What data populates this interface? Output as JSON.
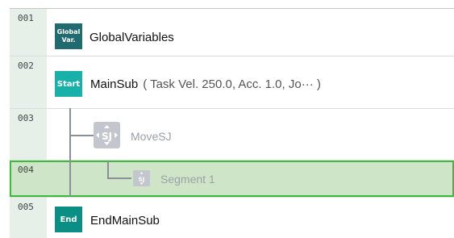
{
  "lines": [
    {
      "num": "001",
      "badge": [
        "Global",
        "Var."
      ],
      "label": "GlobalVariables",
      "params": ""
    },
    {
      "num": "002",
      "badge": [
        "Start"
      ],
      "label": "MainSub",
      "params": "( Task Vel. 250.0, Acc. 1.0, Jo··· )"
    },
    {
      "num": "003",
      "badge": [],
      "label": "MoveSJ",
      "params": ""
    },
    {
      "num": "004",
      "badge": [],
      "label": "Segment 1",
      "params": ""
    },
    {
      "num": "005",
      "badge": [
        "End"
      ],
      "label": "EndMainSub",
      "params": ""
    }
  ],
  "icons": {
    "move_sj": "sj-motion-icon",
    "segment": "sj-segment-icon"
  },
  "colors": {
    "gutter": "#e6f0e8",
    "selected_row_bg": "#cfe5c8",
    "selected_row_border": "#3cba3c",
    "badge_global": "#1f6b6f",
    "badge_start": "#18b0a8",
    "badge_end": "#0b8f84",
    "tree_line": "#8a8f9a"
  },
  "selected_line": "004"
}
